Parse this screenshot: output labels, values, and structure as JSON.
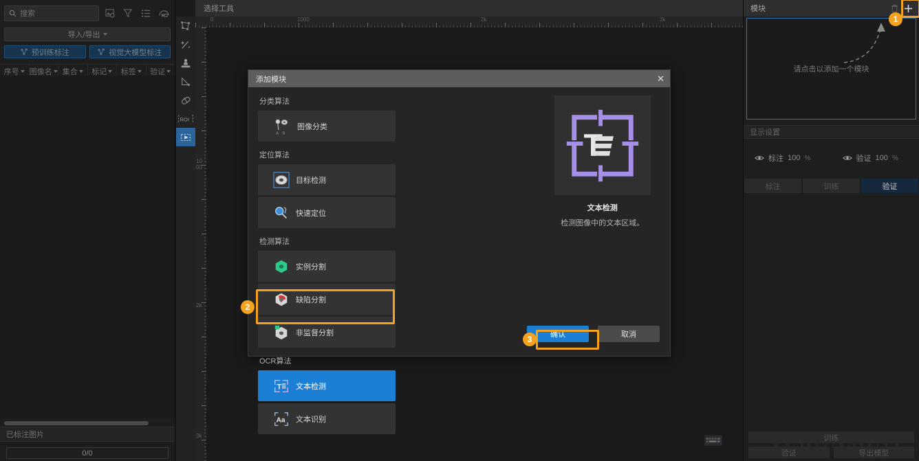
{
  "left_panel": {
    "search_placeholder": "搜索",
    "icons": [
      "image-settings-icon",
      "filter-icon",
      "list-icon",
      "gallery-icon"
    ],
    "import_export_label": "导入/导出",
    "pretrain_label": "预训练标注",
    "vlm_label": "视觉大模型标注",
    "columns": [
      {
        "label": "序号"
      },
      {
        "label": "图像名"
      },
      {
        "label": "集合"
      },
      {
        "label": "标记"
      },
      {
        "label": "标签"
      },
      {
        "label": "验证"
      }
    ],
    "labeled_section": "已标注图片",
    "count": "0/0"
  },
  "toolbar": {
    "tools": [
      {
        "name": "polygon-tool"
      },
      {
        "name": "magic-wand-tool"
      },
      {
        "name": "stamp-tool"
      },
      {
        "name": "eraser-corner-tool"
      },
      {
        "name": "pill-tool"
      },
      {
        "name": "roi-tool",
        "label": "ROI"
      },
      {
        "name": "select-move-tool",
        "active": true
      }
    ]
  },
  "canvas": {
    "title": "选择工具",
    "ruler_h_labels": [
      "0",
      "1000",
      "2k",
      "3k"
    ],
    "ruler_v_labels": [
      "1000",
      "2k",
      "3k"
    ],
    "keyboard_icon": "keyboard-icon"
  },
  "right_panel": {
    "title": "模块",
    "delete_icon": "trash-icon",
    "add_icon": "plus-icon",
    "empty_hint": "请点击以添加一个模块",
    "display_settings": "显示设置",
    "eyes": [
      {
        "icon": "eye-icon",
        "label": "标注",
        "value": "100",
        "unit": "%"
      },
      {
        "icon": "eye-icon",
        "label": "验证",
        "value": "100",
        "unit": "%"
      }
    ],
    "tabs": [
      {
        "label": "标注",
        "active": false
      },
      {
        "label": "训练",
        "active": false
      },
      {
        "label": "验证",
        "active": true
      }
    ],
    "bottom_buttons": {
      "train": "训练",
      "validate": "验证",
      "export": "导出模型"
    },
    "watermark": "VISIONMINT"
  },
  "dialog": {
    "title": "添加模块",
    "close_icon": "close-icon",
    "groups": [
      {
        "label": "分类算法",
        "cards": [
          {
            "name": "图像分类",
            "icon": "image-classification-icon",
            "selected": false
          }
        ]
      },
      {
        "label": "定位算法",
        "cards": [
          {
            "name": "目标检测",
            "icon": "object-detection-icon",
            "selected": false
          },
          {
            "name": "快速定位",
            "icon": "fast-locate-icon",
            "selected": false
          }
        ]
      },
      {
        "label": "检测算法",
        "cards": [
          {
            "name": "实例分割",
            "icon": "instance-segmentation-icon",
            "selected": false
          },
          {
            "name": "缺陷分割",
            "icon": "defect-segmentation-icon",
            "selected": false
          },
          {
            "name": "非监督分割",
            "icon": "unsupervised-segmentation-icon",
            "selected": false
          }
        ]
      },
      {
        "label": "OCR算法",
        "cards": [
          {
            "name": "文本检测",
            "icon": "text-detection-icon",
            "selected": true
          },
          {
            "name": "文本识别",
            "icon": "text-recognition-icon",
            "selected": false
          }
        ]
      }
    ],
    "preview": {
      "icon": "text-detection-preview-icon",
      "title": "文本检测",
      "description": "检测图像中的文本区域。"
    },
    "ok_label": "确认",
    "cancel_label": "取消"
  },
  "annotations": {
    "badges": [
      {
        "number": "1",
        "target": "add-module-button"
      },
      {
        "number": "2",
        "target": "text-detection-card"
      },
      {
        "number": "3",
        "target": "confirm-button"
      }
    ],
    "highlight_color": "#f5a21e"
  }
}
